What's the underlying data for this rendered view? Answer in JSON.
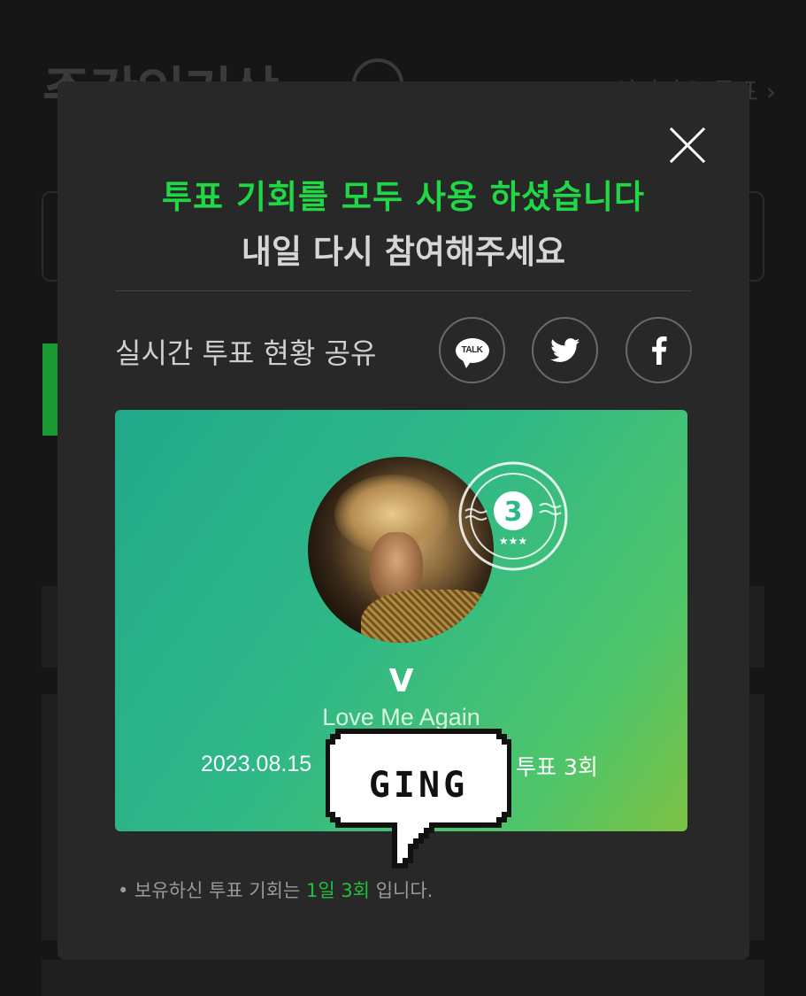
{
  "background": {
    "page_title": "주간인기상",
    "link_text": "인기가요 투표 ›"
  },
  "modal": {
    "message_primary": "투표 기회를 모두 사용 하셨습니다",
    "message_secondary": "내일 다시 참여해주세요",
    "share_label": "실시간 투표 현황 공유",
    "share_buttons": [
      {
        "name": "kakaotalk",
        "label": "TALK",
        "icon": "kakao-talk-icon"
      },
      {
        "name": "twitter",
        "icon": "twitter-bird-icon"
      },
      {
        "name": "facebook",
        "icon": "facebook-icon"
      }
    ],
    "card": {
      "stamp_number": "3",
      "stamp_stars": "★★★",
      "artist": "V",
      "song": "Love Me Again",
      "date": "2023.08.15",
      "vote_count": "투표 3회"
    },
    "sticker_text": "GING",
    "note": {
      "prefix": "• 보유하신 투표 기회는 ",
      "highlight": "1일 3회",
      "suffix": " 입니다."
    }
  },
  "colors": {
    "accent_green": "#20d845",
    "modal_bg": "#282828",
    "page_bg": "#161616"
  }
}
